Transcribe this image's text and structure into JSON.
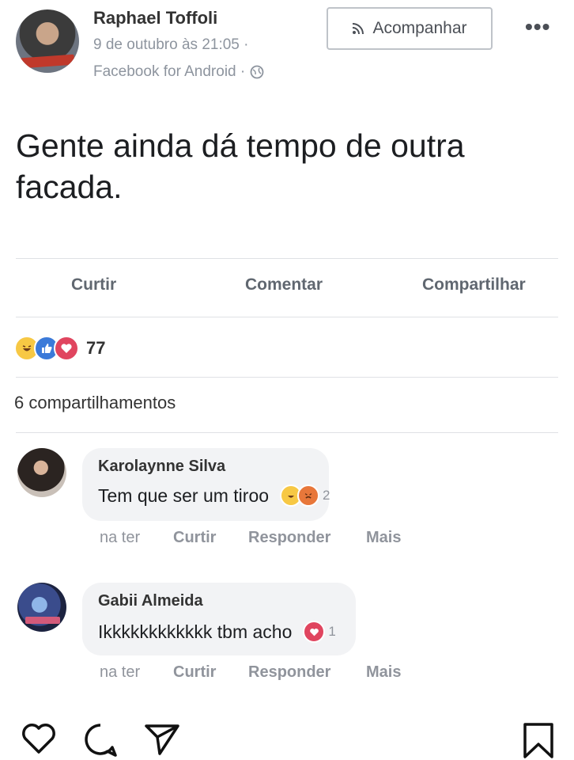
{
  "post": {
    "author": "Raphael Toffoli",
    "date": "9 de outubro às 21:05 ·",
    "source": "Facebook for Android ·",
    "follow_label": "Acompanhar",
    "more_label": "•••",
    "text": "Gente ainda dá tempo de outra facada."
  },
  "actions": {
    "like": "Curtir",
    "comment": "Comentar",
    "share": "Compartilhar"
  },
  "reactions": {
    "types": [
      "haha",
      "like",
      "love"
    ],
    "count": "77"
  },
  "shares_label": "6 compartilhamentos",
  "comments": [
    {
      "name": "Karolaynne Silva",
      "text": "Tem que ser um tiroo",
      "reactions": [
        "haha",
        "angry"
      ],
      "reaction_count": "2",
      "time": "na ter",
      "like": "Curtir",
      "reply": "Responder",
      "more": "Mais"
    },
    {
      "name": "Gabii Almeida",
      "text": "Ikkkkkkkkkkkk tbm acho",
      "reactions": [
        "love"
      ],
      "reaction_count": "1",
      "time": "na ter",
      "like": "Curtir",
      "reply": "Responder",
      "more": "Mais"
    }
  ],
  "bottom_bar": {
    "icons": [
      "heart-icon",
      "comment-icon",
      "send-icon",
      "bookmark-icon"
    ]
  }
}
